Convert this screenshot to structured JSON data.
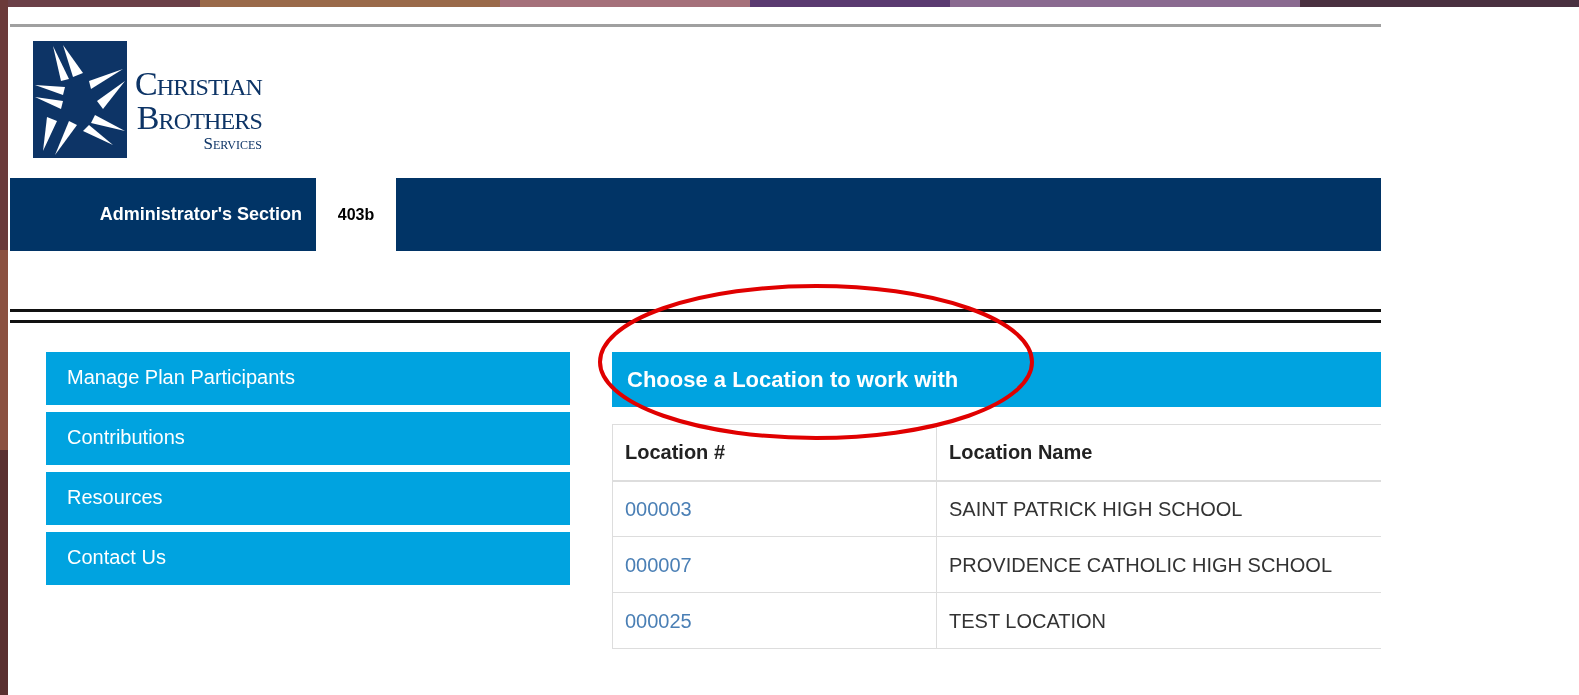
{
  "logo": {
    "lines": [
      "Christian",
      "Brothers",
      "Services"
    ]
  },
  "header_bar": {
    "section": "Administrator's Section",
    "plan": "403b"
  },
  "sidebar": {
    "items": [
      {
        "label": "Manage Plan Participants"
      },
      {
        "label": "Contributions"
      },
      {
        "label": "Resources"
      },
      {
        "label": "Contact Us"
      }
    ]
  },
  "panel": {
    "title": "Choose a Location to work with"
  },
  "table": {
    "columns": [
      "Location #",
      "Location Name"
    ],
    "rows": [
      {
        "number": "000003",
        "name": "SAINT PATRICK HIGH SCHOOL"
      },
      {
        "number": "000007",
        "name": "PROVIDENCE CATHOLIC HIGH SCHOOL"
      },
      {
        "number": "000025",
        "name": "TEST LOCATION"
      }
    ]
  }
}
